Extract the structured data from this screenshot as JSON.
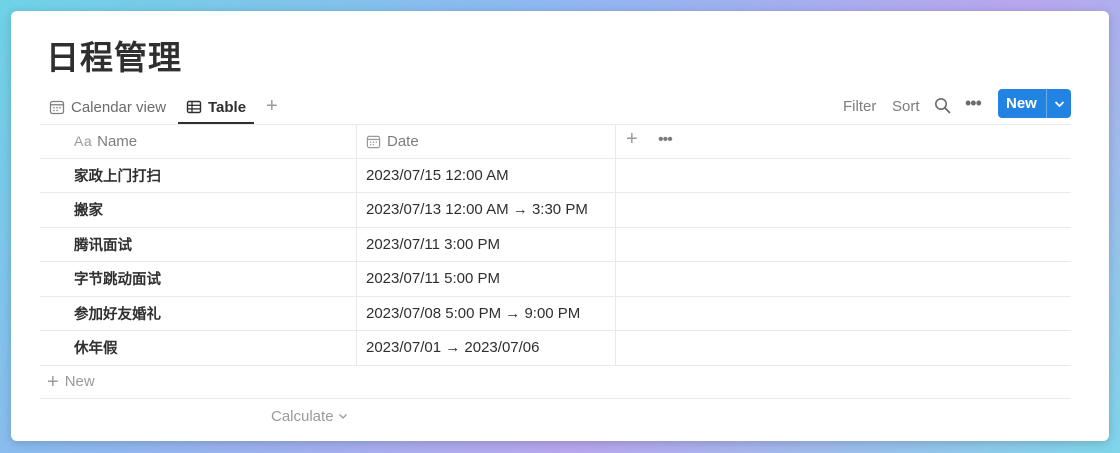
{
  "page": {
    "title": "日程管理"
  },
  "views": {
    "tabs": [
      {
        "label": "Calendar view",
        "icon": "calendar-icon",
        "active": false
      },
      {
        "label": "Table",
        "icon": "table-icon",
        "active": true
      }
    ],
    "add_icon": "plus-icon"
  },
  "toolbar": {
    "filter_label": "Filter",
    "sort_label": "Sort",
    "search_icon": "search-icon",
    "more_icon": "more-icon",
    "new_label": "New",
    "new_color": "#2383e2"
  },
  "table": {
    "columns": [
      {
        "prefix": "Aa",
        "label": "Name"
      },
      {
        "icon": "calendar-icon",
        "label": "Date"
      }
    ],
    "rows": [
      {
        "name": "家政上门打扫",
        "date": "2023/07/15 12:00 AM"
      },
      {
        "name": "搬家",
        "date": "2023/07/13 12:00 AM → 3:30 PM"
      },
      {
        "name": "腾讯面试",
        "date": "2023/07/11 3:00 PM"
      },
      {
        "name": "字节跳动面试",
        "date": "2023/07/11 5:00 PM"
      },
      {
        "name": "参加好友婚礼",
        "date": "2023/07/08 5:00 PM → 9:00 PM"
      },
      {
        "name": "休年假",
        "date": "2023/07/01 → 2023/07/06"
      }
    ],
    "new_row_label": "New",
    "calculate_label": "Calculate"
  },
  "colors": {
    "accent": "#2383e2",
    "text": "#2f2f2f",
    "muted": "#7d7d7d",
    "border": "#e9e9e7"
  }
}
